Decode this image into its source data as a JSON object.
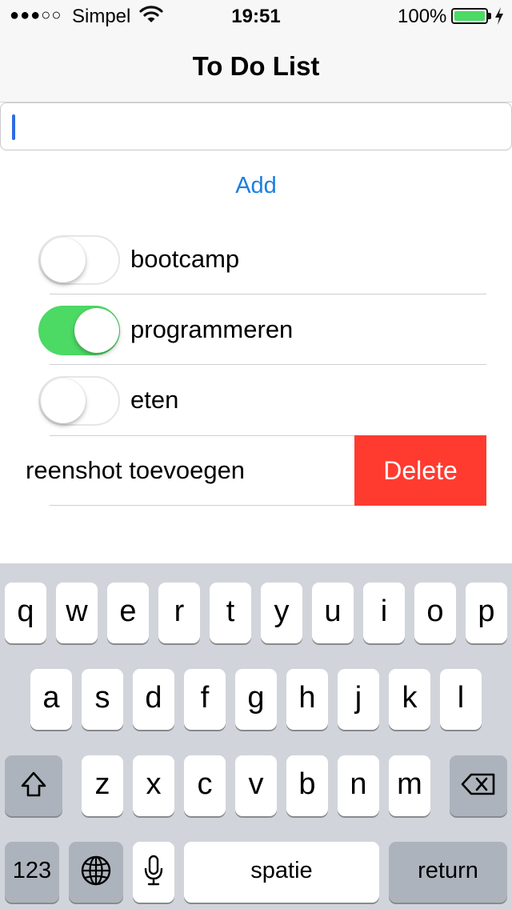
{
  "status_bar": {
    "signal": "●●●○○",
    "carrier": "Simpel",
    "time": "19:51",
    "battery": "100%"
  },
  "nav": {
    "title": "To Do List"
  },
  "input": {
    "value": "",
    "placeholder": ""
  },
  "add_label": "Add",
  "todos": [
    {
      "label": "bootcamp",
      "done": false
    },
    {
      "label": "programmeren",
      "done": true
    },
    {
      "label": "eten",
      "done": false
    }
  ],
  "swiped_item": {
    "label": "reenshot toevoegen",
    "delete_label": "Delete"
  },
  "keyboard": {
    "row1": [
      "q",
      "w",
      "e",
      "r",
      "t",
      "y",
      "u",
      "i",
      "o",
      "p"
    ],
    "row2": [
      "a",
      "s",
      "d",
      "f",
      "g",
      "h",
      "j",
      "k",
      "l"
    ],
    "row3": [
      "z",
      "x",
      "c",
      "v",
      "b",
      "n",
      "m"
    ],
    "numbers_label": "123",
    "space_label": "spatie",
    "return_label": "return"
  },
  "colors": {
    "accent": "#1a7fe0",
    "toggle_on": "#4cd964",
    "delete": "#ff3b30",
    "keyboard_bg": "#d1d5db"
  },
  "icons": [
    "wifi-icon",
    "battery-icon",
    "charging-bolt-icon",
    "shift-icon",
    "backspace-icon",
    "globe-icon",
    "microphone-icon"
  ]
}
